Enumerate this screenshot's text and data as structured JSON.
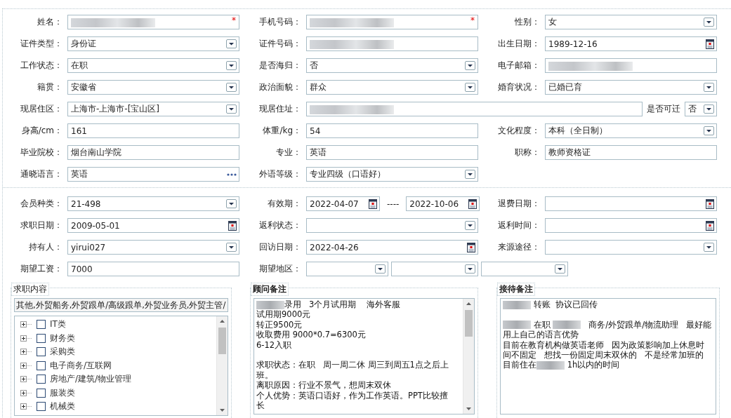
{
  "sections": [
    {
      "rows": [
        {
          "cells": [
            {
              "label": "姓名：",
              "fields": [
                {
                  "kind": "text",
                  "redacted": true,
                  "required_mark": "*"
                }
              ]
            },
            {
              "label": "手机号码：",
              "fields": [
                {
                  "kind": "text",
                  "redacted": true,
                  "required_mark": "*"
                }
              ]
            },
            {
              "label": "性别：",
              "fields": [
                {
                  "kind": "select",
                  "value": "女"
                }
              ]
            }
          ]
        },
        {
          "cells": [
            {
              "label": "证件类型：",
              "fields": [
                {
                  "kind": "select",
                  "value": "身份证"
                }
              ]
            },
            {
              "label": "证件号码：",
              "fields": [
                {
                  "kind": "text",
                  "redacted": true
                }
              ]
            },
            {
              "label": "出生日期：",
              "fields": [
                {
                  "kind": "date",
                  "value": "1989-12-16"
                }
              ]
            }
          ]
        },
        {
          "cells": [
            {
              "label": "工作状态：",
              "fields": [
                {
                  "kind": "select",
                  "value": "在职"
                }
              ]
            },
            {
              "label": "是否海归：",
              "fields": [
                {
                  "kind": "select",
                  "value": "否"
                }
              ]
            },
            {
              "label": "电子邮箱：",
              "fields": [
                {
                  "kind": "text",
                  "redacted": true
                }
              ]
            }
          ]
        },
        {
          "cells": [
            {
              "label": "籍贯：",
              "fields": [
                {
                  "kind": "select",
                  "value": "安徽省"
                }
              ]
            },
            {
              "label": "政治面貌：",
              "fields": [
                {
                  "kind": "select",
                  "value": "群众"
                }
              ]
            },
            {
              "label": "婚育状况：",
              "fields": [
                {
                  "kind": "select",
                  "value": "已婚已育"
                }
              ]
            }
          ]
        },
        {
          "cells": [
            {
              "label": "现居住区：",
              "fields": [
                {
                  "kind": "select",
                  "value": " 上海市-上海市-[宝山区]"
                }
              ]
            },
            {
              "label": "现居住址：",
              "kind": "address",
              "fields": [
                {
                  "kind": "text",
                  "redacted": true
                },
                {
                  "kind": "label",
                  "text": "是否可迁"
                },
                {
                  "kind": "select",
                  "value": "否"
                }
              ]
            }
          ]
        },
        {
          "cells": [
            {
              "label": "身高/cm：",
              "fields": [
                {
                  "kind": "text",
                  "value": "161"
                }
              ]
            },
            {
              "label": "体重/kg：",
              "fields": [
                {
                  "kind": "text",
                  "value": "54"
                }
              ]
            },
            {
              "label": "文化程度：",
              "fields": [
                {
                  "kind": "select",
                  "value": "本科（全日制）"
                }
              ]
            }
          ]
        },
        {
          "cells": [
            {
              "label": "毕业院校：",
              "fields": [
                {
                  "kind": "text",
                  "value": "烟台南山学院"
                }
              ]
            },
            {
              "label": "专业：",
              "fields": [
                {
                  "kind": "text",
                  "value": "英语"
                }
              ]
            },
            {
              "label": "职称：",
              "fields": [
                {
                  "kind": "text",
                  "value": "教师资格证"
                }
              ]
            }
          ]
        },
        {
          "cells": [
            {
              "label": "通晓语言：",
              "fields": [
                {
                  "kind": "lookup",
                  "value": "英语"
                }
              ]
            },
            {
              "label": "外语等级：",
              "fields": [
                {
                  "kind": "select",
                  "value": "专业四级（口语好）"
                }
              ]
            }
          ]
        }
      ]
    },
    {
      "rows": [
        {
          "cells": [
            {
              "label": "会员种类：",
              "fields": [
                {
                  "kind": "select",
                  "value": " 21-498"
                }
              ]
            },
            {
              "label": "有效期：",
              "kind": "range",
              "fields": [
                {
                  "kind": "date",
                  "value": "2022-04-07"
                },
                {
                  "kind": "separator",
                  "text": "----"
                },
                {
                  "kind": "date",
                  "value": "2022-10-06"
                }
              ]
            },
            {
              "label": "退费日期：",
              "fields": [
                {
                  "kind": "date"
                }
              ]
            }
          ]
        },
        {
          "cells": [
            {
              "label": "求职日期：",
              "fields": [
                {
                  "kind": "date",
                  "value": "2009-05-01"
                }
              ]
            },
            {
              "label": "返利状态：",
              "fields": [
                {
                  "kind": "select"
                }
              ]
            },
            {
              "label": "返利时间：",
              "fields": [
                {
                  "kind": "date"
                }
              ]
            }
          ]
        },
        {
          "cells": [
            {
              "label": "持有人：",
              "fields": [
                {
                  "kind": "select",
                  "value": "yirui027"
                }
              ]
            },
            {
              "label": "回访日期：",
              "fields": [
                {
                  "kind": "date",
                  "value": "2022-04-26"
                }
              ]
            },
            {
              "label": "来源途径：",
              "fields": [
                {
                  "kind": "select"
                }
              ]
            }
          ]
        },
        {
          "cells": [
            {
              "label": "期望工资：",
              "fields": [
                {
                  "kind": "text",
                  "value": "7000"
                }
              ]
            },
            {
              "label": "期望地区：",
              "kind": "regions",
              "fields": [
                {
                  "kind": "select"
                },
                {
                  "kind": "select"
                },
                {
                  "kind": "select"
                }
              ]
            }
          ]
        }
      ]
    }
  ],
  "job_panel": {
    "legend": "求职内容",
    "summary": "其他,外贸船务,外贸跟单/高级跟单,外贸业务员,外贸主管/",
    "tree": [
      {
        "label": "IT类",
        "expanded": false,
        "checked": false
      },
      {
        "label": "财务类",
        "expanded": false,
        "checked": false
      },
      {
        "label": "采购类",
        "expanded": false,
        "checked": false
      },
      {
        "label": "电子商务/互联网",
        "expanded": false,
        "checked": false
      },
      {
        "label": "房地产/建筑/物业管理",
        "expanded": false,
        "checked": false
      },
      {
        "label": "服装类",
        "expanded": false,
        "checked": false
      },
      {
        "label": "机械类",
        "expanded": false,
        "checked": false
      }
    ]
  },
  "notes": [
    {
      "legend": "顾问备注",
      "scrollable": true,
      "lines": [
        {
          "parts": [
            {
              "redacted": true
            },
            {
              "text": "录用   3个月试用期    海外客服"
            }
          ]
        },
        {
          "parts": [
            {
              "text": "试用期9000元"
            }
          ]
        },
        {
          "parts": [
            {
              "text": "转正9500元"
            }
          ]
        },
        {
          "parts": [
            {
              "text": "收取费用 9000*0.7=6300元"
            }
          ]
        },
        {
          "parts": [
            {
              "text": "6-12入职"
            }
          ]
        },
        {
          "blank": true
        },
        {
          "parts": [
            {
              "text": "求职状态：在职   周一周二休 周三到周五1点之后上"
            }
          ]
        },
        {
          "parts": [
            {
              "text": "班。"
            }
          ]
        },
        {
          "parts": [
            {
              "text": "离职原因：行业不景气，想周末双休"
            }
          ]
        },
        {
          "parts": [
            {
              "text": "个人优势：英语口语好，作为工作英语。PPT比较擅"
            }
          ]
        },
        {
          "parts": [
            {
              "text": "长"
            }
          ]
        }
      ]
    },
    {
      "legend": "接待备注",
      "scrollable": false,
      "lines": [
        {
          "parts": [
            {
              "redacted": true
            },
            {
              "text": " 转账  协议已回传"
            }
          ]
        },
        {
          "blank": true
        },
        {
          "parts": [
            {
              "redacted": true
            },
            {
              "text": " 在职 "
            },
            {
              "redacted": true
            },
            {
              "text": "   商务/外贸跟单/物流助理   最好能"
            }
          ]
        },
        {
          "parts": [
            {
              "text": "用上自己的语言优势"
            }
          ]
        },
        {
          "parts": [
            {
              "text": "目前在教育机构做英语老师   因为政策影响加上休息时"
            }
          ]
        },
        {
          "parts": [
            {
              "text": "间不固定   想找一份固定周末双休的   不是经常加班的"
            }
          ]
        },
        {
          "parts": [
            {
              "text": "目前住在"
            },
            {
              "redacted": true
            },
            {
              "text": " 1h以内的时间"
            }
          ]
        }
      ]
    }
  ]
}
